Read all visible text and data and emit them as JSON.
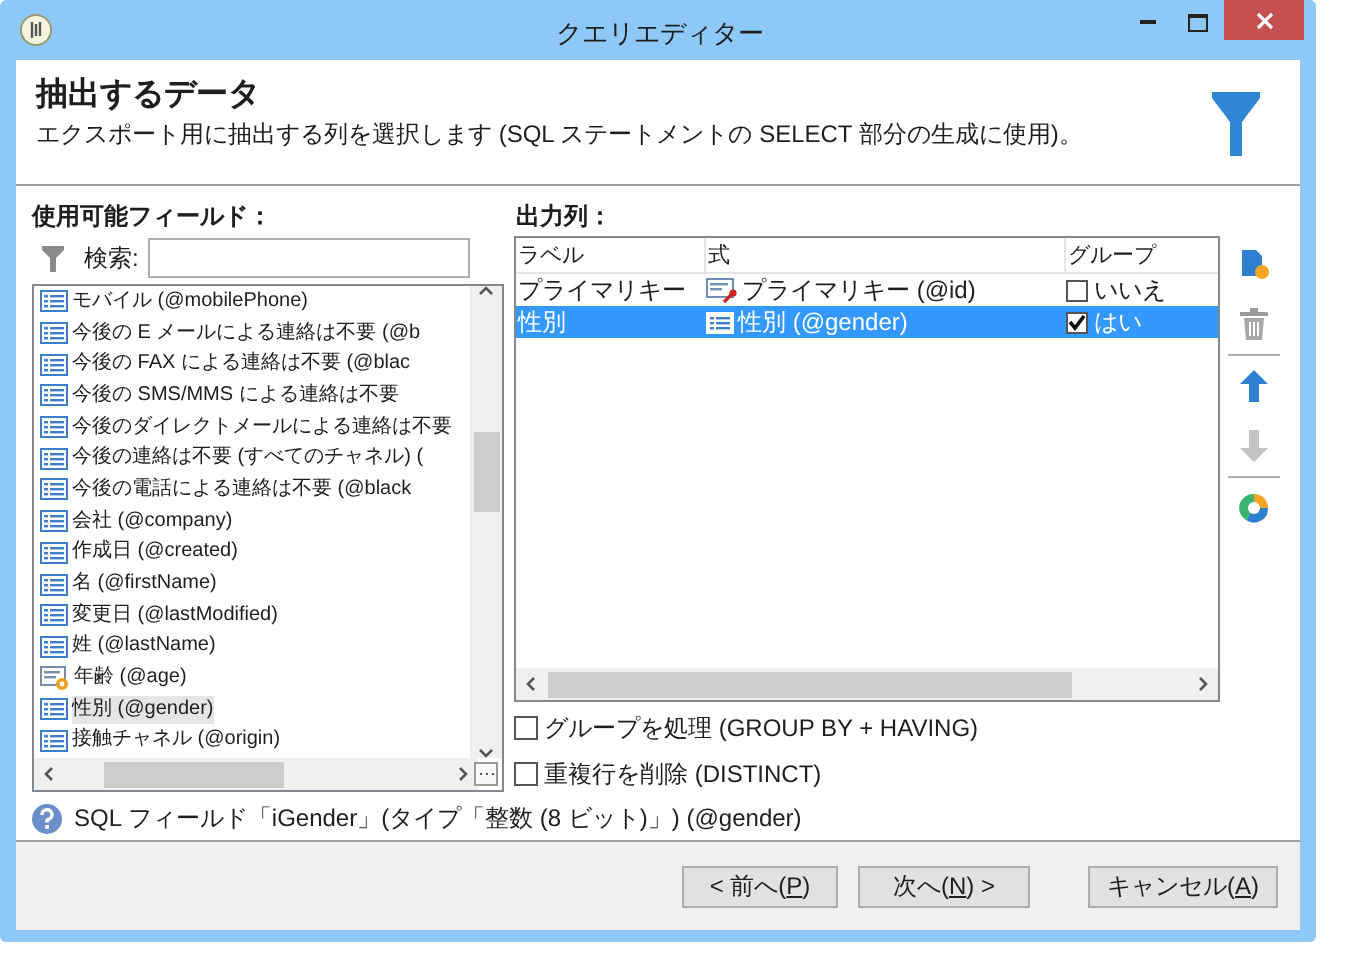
{
  "window": {
    "title": "クエリエディター"
  },
  "header": {
    "title": "抽出するデータ",
    "description": "エクスポート用に抽出する列を選択します (SQL ステートメントの SELECT 部分の生成に使用)。"
  },
  "available_fields": {
    "label": "使用可能フィールド：",
    "search_label": "検索:",
    "items": [
      {
        "label": "モバイル (@mobilePhone)",
        "kind": "field",
        "selected": false
      },
      {
        "label": "今後の E メールによる連絡は不要 (@b",
        "kind": "field",
        "selected": false
      },
      {
        "label": "今後の FAX による連絡は不要 (@blac",
        "kind": "field",
        "selected": false
      },
      {
        "label": "今後の SMS/MMS による連絡は不要",
        "kind": "field",
        "selected": false
      },
      {
        "label": "今後のダイレクトメールによる連絡は不要",
        "kind": "field",
        "selected": false
      },
      {
        "label": "今後の連絡は不要 (すべてのチャネル) (",
        "kind": "field",
        "selected": false
      },
      {
        "label": "今後の電話による連絡は不要 (@black",
        "kind": "field",
        "selected": false
      },
      {
        "label": "会社 (@company)",
        "kind": "field",
        "selected": false
      },
      {
        "label": "作成日 (@created)",
        "kind": "field",
        "selected": false
      },
      {
        "label": "名 (@firstName)",
        "kind": "field",
        "selected": false
      },
      {
        "label": "変更日 (@lastModified)",
        "kind": "field",
        "selected": false
      },
      {
        "label": "姓 (@lastName)",
        "kind": "field",
        "selected": false
      },
      {
        "label": "年齢 (@age)",
        "kind": "computed",
        "selected": false
      },
      {
        "label": "性別 (@gender)",
        "kind": "field",
        "selected": true
      },
      {
        "label": "接触チャネル (@origin)",
        "kind": "field",
        "selected": false
      }
    ]
  },
  "output_columns": {
    "label": "出力列：",
    "columns": [
      "ラベル",
      "式",
      "グループ"
    ],
    "rows": [
      {
        "label": "プライマリキー",
        "expression": "プライマリキー (@id)",
        "kind": "key",
        "group_checked": false,
        "group_label": "いいえ",
        "selected": false
      },
      {
        "label": "性別",
        "expression": "性別 (@gender)",
        "kind": "field",
        "group_checked": true,
        "group_label": "はい",
        "selected": true
      }
    ]
  },
  "options": [
    {
      "label": "グループを処理 (GROUP BY + HAVING)",
      "checked": false
    },
    {
      "label": "重複行を削除 (DISTINCT)",
      "checked": false
    }
  ],
  "info_text": "SQL フィールド「iGender」(タイプ「整数 (8 ビット)」) (@gender)",
  "buttons": [
    {
      "before": "< 前へ(",
      "mnemonic": "P",
      "after": ")"
    },
    {
      "before": "次へ(",
      "mnemonic": "N",
      "after": ") >"
    },
    {
      "before": "キャンセル(",
      "mnemonic": "A",
      "after": ")"
    }
  ]
}
